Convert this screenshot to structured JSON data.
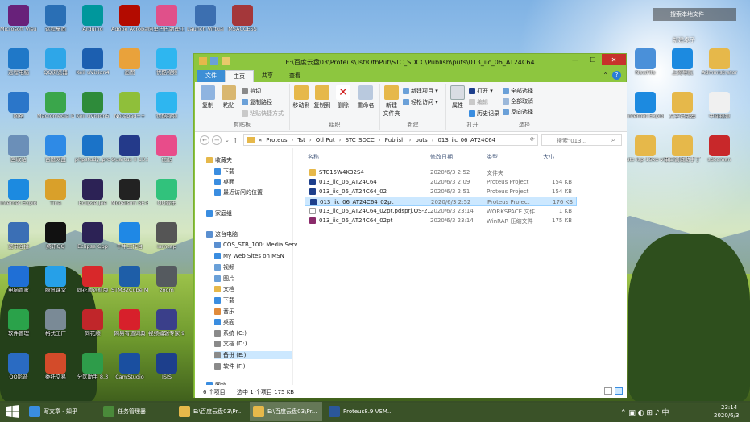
{
  "desktop_icons_left": [
    {
      "label": "Microsoft Visual Studio...",
      "icon": "visual-studio-icon",
      "color": "#68217a"
    },
    {
      "label": "远程桌面",
      "icon": "remote-desktop-icon",
      "color": "#2a6fb5"
    },
    {
      "label": "Arduino",
      "icon": "arduino-icon",
      "color": "#00979c"
    },
    {
      "label": "Adobe Acrobat DC",
      "icon": "acrobat-icon",
      "color": "#b30b00"
    },
    {
      "label": "阿里巴巴助理工具",
      "icon": "tool-icon",
      "color": "#e0508a"
    },
    {
      "label": "Launch Virtual Serial Po...",
      "icon": "serial-port-icon",
      "color": "#3c6fb0"
    },
    {
      "label": "MSACCESS",
      "icon": "access-icon",
      "color": "#a4373a"
    },
    {
      "label": "远程电脑",
      "icon": "computer-icon",
      "color": "#1f78c8"
    },
    {
      "label": "QQ浏览器",
      "icon": "qq-browser-icon",
      "color": "#2ea6e8"
    },
    {
      "label": "Keil uVision4",
      "icon": "keil4-icon",
      "color": "#1c5fb0"
    },
    {
      "label": "画图",
      "icon": "paint-icon",
      "color": "#e9a23b"
    },
    {
      "label": "优酷视频",
      "icon": "youku-icon",
      "color": "#2eb6f0"
    },
    {
      "label": "网络",
      "icon": "network-icon",
      "color": "#2b76c9"
    },
    {
      "label": "Macromedia Dreamwea...",
      "icon": "dreamweaver-icon",
      "color": "#3aa64b"
    },
    {
      "label": "Keil uVision5",
      "icon": "keil5-icon",
      "color": "#2e8b3a"
    },
    {
      "label": "Notepad++",
      "icon": "notepad-icon",
      "color": "#8fbf3a"
    },
    {
      "label": "优酷视频",
      "icon": "youku-icon",
      "color": "#2eb6f0"
    },
    {
      "label": "回收站",
      "icon": "recycle-bin-icon",
      "color": "#6b8fb8"
    },
    {
      "label": "百度网盘",
      "icon": "baidu-netdisk-icon",
      "color": "#2e8ae6"
    },
    {
      "label": "phpstudy_pro",
      "icon": "phpstudy-icon",
      "color": "#1b73c8"
    },
    {
      "label": "Quartus II 13.0sp1 (64...",
      "icon": "quartus-icon",
      "color": "#243a8a"
    },
    {
      "label": "优酷",
      "icon": "youku-icon",
      "color": "#e84c8a"
    },
    {
      "label": "Internet Explorer",
      "icon": "ie-icon",
      "color": "#1c8ae0"
    },
    {
      "label": "Tina",
      "icon": "tina-icon",
      "color": "#d9a02a"
    },
    {
      "label": "Eclipse Jee",
      "icon": "eclipse-icon",
      "color": "#2c2255"
    },
    {
      "label": "Modelsim SE-64 10.4",
      "icon": "modelsim-icon",
      "color": "#222222"
    },
    {
      "label": "QQ音乐",
      "icon": "qq-music-icon",
      "color": "#31c27c"
    },
    {
      "label": "宽带连接",
      "icon": "broadband-icon",
      "color": "#3b6fb5"
    },
    {
      "label": "腾讯QQ",
      "icon": "qq-icon",
      "color": "#111111"
    },
    {
      "label": "Eclipse Cpp",
      "icon": "eclipse-icon",
      "color": "#2c2255"
    },
    {
      "label": "千牛工作台",
      "icon": "qianniu-icon",
      "color": "#1f88e5"
    },
    {
      "label": "iamcap",
      "icon": "camera-icon",
      "color": "#555555"
    },
    {
      "label": "电脑管家",
      "icon": "pc-manager-icon",
      "color": "#1f6fd6"
    },
    {
      "label": "腾讯课堂",
      "icon": "tencent-class-icon",
      "color": "#26a0e8"
    },
    {
      "label": "同花顺远航版",
      "icon": "tonghuashun-icon",
      "color": "#d8282a"
    },
    {
      "label": "STM32Cube MX",
      "icon": "stm32-icon",
      "color": "#1e5ea8"
    },
    {
      "label": "zoom",
      "icon": "zoom-icon",
      "color": "#555a5f"
    },
    {
      "label": "软件管理",
      "icon": "software-manager-icon",
      "color": "#2aa24a"
    },
    {
      "label": "格式工厂",
      "icon": "format-factory-icon",
      "color": "#7a8a96"
    },
    {
      "label": "同花顺",
      "icon": "cards-icon",
      "color": "#c0262a"
    },
    {
      "label": "网易有道词典",
      "icon": "youdao-icon",
      "color": "#d7202b"
    },
    {
      "label": "视频编辑专家 9.3",
      "icon": "video-edit-icon",
      "color": "#3a3f8a"
    },
    {
      "label": "QQ影音",
      "icon": "qq-player-icon",
      "color": "#2a6bc2"
    },
    {
      "label": "委托交易",
      "icon": "trade-icon",
      "color": "#d34b2a"
    },
    {
      "label": "分区助手 8.3",
      "icon": "partition-icon",
      "color": "#2e9c4a"
    },
    {
      "label": "CamStudio",
      "icon": "camstudio-icon",
      "color": "#1a4fa0"
    },
    {
      "label": "ISIS",
      "icon": "isis-icon",
      "color": "#1d3f8c"
    }
  ],
  "desktop_icons_right": [
    {
      "label": "NewFile",
      "icon": "file-icon",
      "color": "#4a90d9"
    },
    {
      "label": "上网导航",
      "icon": "ie-icon",
      "color": "#1c8ae0"
    },
    {
      "label": "Administrator",
      "icon": "user-folder-icon",
      "color": "#e6b84a"
    },
    {
      "label": "Internet Explorer",
      "icon": "ie-icon",
      "color": "#1c8ae0"
    },
    {
      "label": "文字识别器",
      "icon": "folder-icon",
      "color": "#e6b84a"
    },
    {
      "label": "中间视频",
      "icon": "document-icon",
      "color": "#f0f0f0"
    },
    {
      "label": "stc-isp-15xx-v6.87E",
      "icon": "folder-icon",
      "color": "#e6b84a"
    },
    {
      "label": "串口调试助手丁丁",
      "icon": "folder-icon",
      "color": "#e6b84a"
    },
    {
      "label": "sdccman",
      "icon": "pdf-icon",
      "color": "#c8282a"
    }
  ],
  "desktop_search": {
    "label": "搜索本地文件"
  },
  "desktop_newfolder": {
    "label": "新建桌子"
  },
  "window": {
    "title": "E:\\百度云盘03\\Proteus\\Tst\\OthPut\\STC_SDCC\\Publish\\puts\\013_iic_06_AT24C64",
    "tabs": [
      "文件",
      "主页",
      "共享",
      "查看"
    ],
    "ribbon": {
      "clipboard": {
        "name": "剪贴板",
        "copy": "复制",
        "paste": "粘贴",
        "cut": "剪切",
        "copy_path": "复制路径",
        "paste_shortcut": "粘贴快捷方式"
      },
      "organize": {
        "name": "组织",
        "move_to": "移动到",
        "copy_to": "复制到",
        "delete": "删除",
        "rename": "重命名"
      },
      "new": {
        "name": "新建",
        "new_folder": "新建\n文件夹",
        "new_item": "新建项目 ▾",
        "easy_access": "轻松访问 ▾"
      },
      "open": {
        "name": "打开",
        "properties": "属性",
        "open": "打开 ▾",
        "edit": "编辑",
        "history": "历史记录"
      },
      "select": {
        "name": "选择",
        "select_all": "全部选择",
        "select_none": "全部取消",
        "invert": "反向选择"
      }
    },
    "address": {
      "crumbs": [
        "«",
        "Proteus",
        "Tst",
        "OthPut",
        "STC_SDCC",
        "Publish",
        "puts",
        "013_iic_06_AT24C64"
      ],
      "search_placeholder": "搜索\"013...",
      "refresh_icon": "refresh-icon"
    },
    "nav": {
      "favorites": "收藏夹",
      "fav_items": [
        "下载",
        "桌面",
        "最近访问的位置"
      ],
      "homegroup": "家庭组",
      "this_pc": "这台电脑",
      "pc_items": [
        "COS_STB_100: Media Serv",
        "My Web Sites on MSN",
        "视频",
        "图片",
        "文档",
        "下载",
        "音乐",
        "桌面",
        "系统 (C:)",
        "文档 (D:)",
        "备份 (E:)",
        "软件 (F:)"
      ],
      "network": "网络"
    },
    "columns": {
      "name": "名称",
      "date": "修改日期",
      "type": "类型",
      "size": "大小"
    },
    "files": [
      {
        "name": "STC15W4K32S4",
        "date": "2020/6/3 2:52",
        "type": "文件夹",
        "size": "",
        "icon": "folder-icon",
        "color": "#e6b84a"
      },
      {
        "name": "013_iic_06_AT24C64",
        "date": "2020/6/3 2:09",
        "type": "Proteus Project",
        "size": "154 KB",
        "icon": "proteus-icon",
        "color": "#1d3f8c"
      },
      {
        "name": "013_iic_06_AT24C64_02",
        "date": "2020/6/3 2:51",
        "type": "Proteus Project",
        "size": "154 KB",
        "icon": "proteus-icon",
        "color": "#1d3f8c"
      },
      {
        "name": "013_iic_06_AT24C64_02pt",
        "date": "2020/6/3 2:52",
        "type": "Proteus Project",
        "size": "176 KB",
        "icon": "proteus-icon",
        "color": "#1d3f8c"
      },
      {
        "name": "013_iic_06_AT24C64_02pt.pdsprj.OS-2...",
        "date": "2020/6/3 23:14",
        "type": "WORKSPACE 文件",
        "size": "1 KB",
        "icon": "document-icon",
        "color": "#ffffff"
      },
      {
        "name": "013_iic_06_AT24C64_02pt",
        "date": "2020/6/3 23:14",
        "type": "WinRAR 压缩文件",
        "size": "175 KB",
        "icon": "winrar-icon",
        "color": "#8a2a6a"
      }
    ],
    "selected_row": 3,
    "status": {
      "count": "6 个项目",
      "selected": "选中 1 个项目  175 KB"
    }
  },
  "taskbar": {
    "start_icon": "windows-icon",
    "items": [
      {
        "label": "写文章 - 知乎",
        "icon": "chrome-icon",
        "color": "#3a8de0"
      },
      {
        "label": "任务管理器",
        "icon": "task-manager-icon",
        "color": "#4a8a3a"
      },
      {
        "label": "E:\\百度云盘03\\Pr...",
        "icon": "folder-icon",
        "color": "#e6b84a"
      },
      {
        "label": "E:\\百度云盘03\\Pr...",
        "icon": "folder-icon",
        "color": "#e6b84a"
      },
      {
        "label": "Proteus8.9 VSM...",
        "icon": "word-icon",
        "color": "#2b579a"
      }
    ],
    "time": "23:14",
    "date": "2020/6/3"
  }
}
